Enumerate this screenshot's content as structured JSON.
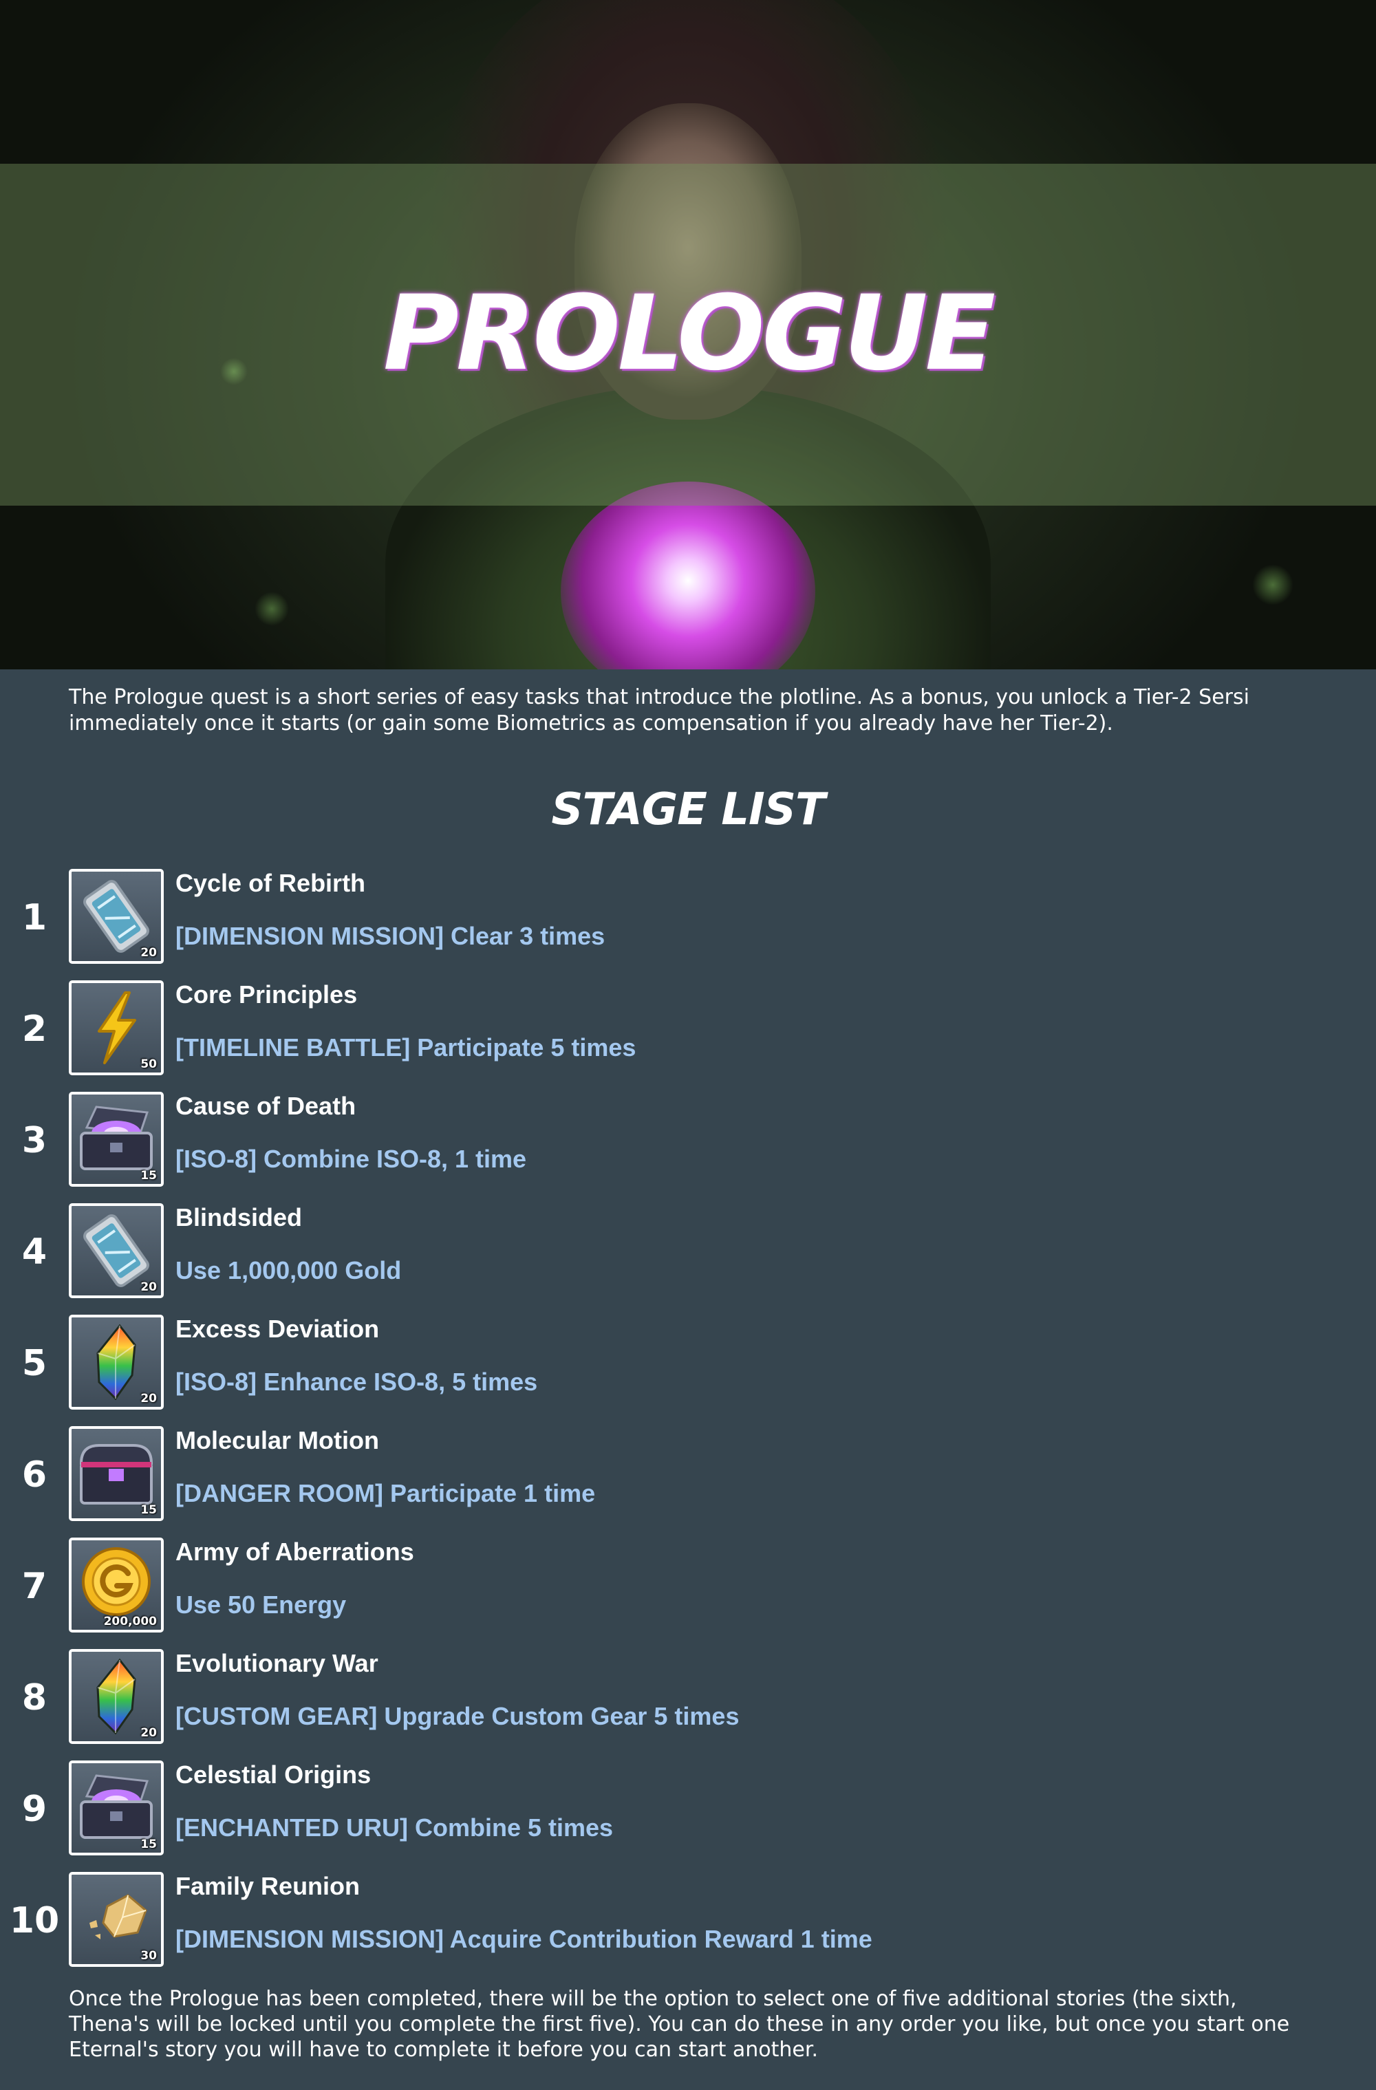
{
  "header": {
    "title": "PROLOGUE"
  },
  "intro": "The Prologue quest is a short series of easy tasks that introduce the plotline. As a bonus, you unlock a Tier-2 Sersi immediately once it starts (or gain some Biometrics as compensation if you already have her Tier-2).",
  "section_title": "STAGE LIST",
  "stages": [
    {
      "number": "1",
      "name": "Cycle of Rebirth",
      "task": "[DIMENSION MISSION] Clear 3 times",
      "icon": "ticket-icon",
      "count": "20"
    },
    {
      "number": "2",
      "name": "Core Principles",
      "task": "[TIMELINE BATTLE] Participate 5 times",
      "icon": "lightning-icon",
      "count": "50"
    },
    {
      "number": "3",
      "name": "Cause of Death",
      "task": "[ISO-8] Combine ISO-8, 1 time",
      "icon": "open-chest-icon",
      "count": "15"
    },
    {
      "number": "4",
      "name": "Blindsided",
      "task": "Use 1,000,000 Gold",
      "icon": "ticket-icon",
      "count": "20"
    },
    {
      "number": "5",
      "name": "Excess Deviation",
      "task": "[ISO-8] Enhance ISO-8, 5 times",
      "icon": "rainbow-crystal-icon",
      "count": "20"
    },
    {
      "number": "6",
      "name": "Molecular Motion",
      "task": "[DANGER ROOM] Participate 1 time",
      "icon": "closed-chest-icon",
      "count": "15"
    },
    {
      "number": "7",
      "name": "Army of Aberrations",
      "task": "Use 50 Energy",
      "icon": "gold-coin-icon",
      "count": "200,000"
    },
    {
      "number": "8",
      "name": "Evolutionary War",
      "task": "[CUSTOM GEAR] Upgrade Custom Gear 5 times",
      "icon": "rainbow-crystal-icon",
      "count": "20"
    },
    {
      "number": "9",
      "name": "Celestial Origins",
      "task": "[ENCHANTED URU] Combine 5 times",
      "icon": "open-chest-icon",
      "count": "15"
    },
    {
      "number": "10",
      "name": "Family Reunion",
      "task": "[DIMENSION MISSION] Acquire Contribution Reward 1 time",
      "icon": "ore-chunk-icon",
      "count": "30"
    }
  ],
  "outro": "Once the Prologue has been completed, there will be the option to select one of five additional stories (the sixth, Thena's will be locked until you complete the first five). You can do these in any order you like, but once you start one Eternal's story you will have to complete it before you can start another.",
  "colors": {
    "background": "#36454f",
    "task_text": "#a4c8ef",
    "title_glow": "#c35fd6"
  }
}
